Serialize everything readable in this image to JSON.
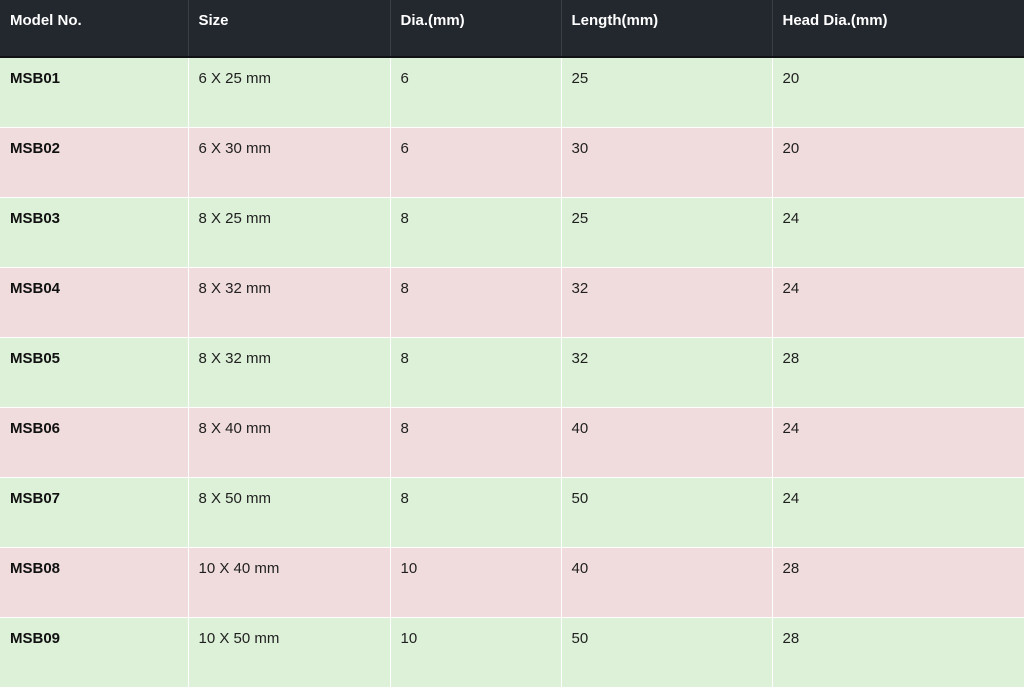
{
  "table": {
    "headers": [
      "Model No.",
      "Size",
      "Dia.(mm)",
      "Length(mm)",
      "Head Dia.(mm)"
    ],
    "rows": [
      [
        "MSB01",
        "6 X 25 mm",
        "6",
        "25",
        "20"
      ],
      [
        "MSB02",
        "6 X 30 mm",
        "6",
        "30",
        "20"
      ],
      [
        "MSB03",
        "8 X 25 mm",
        "8",
        "25",
        "24"
      ],
      [
        "MSB04",
        "8 X 32 mm",
        "8",
        "32",
        "24"
      ],
      [
        "MSB05",
        "8 X 32 mm",
        "8",
        "32",
        "28"
      ],
      [
        "MSB06",
        "8 X 40 mm",
        "8",
        "40",
        "24"
      ],
      [
        "MSB07",
        "8 X 50 mm",
        "8",
        "50",
        "24"
      ],
      [
        "MSB08",
        "10 X 40 mm",
        "10",
        "40",
        "28"
      ],
      [
        "MSB09",
        "10 X 50 mm",
        "10",
        "50",
        "28"
      ]
    ]
  },
  "colors": {
    "header_bg": "#23272e",
    "header_text": "#ffffff",
    "row_green": "#ddf0d8",
    "row_pink": "#f1dcdd"
  }
}
